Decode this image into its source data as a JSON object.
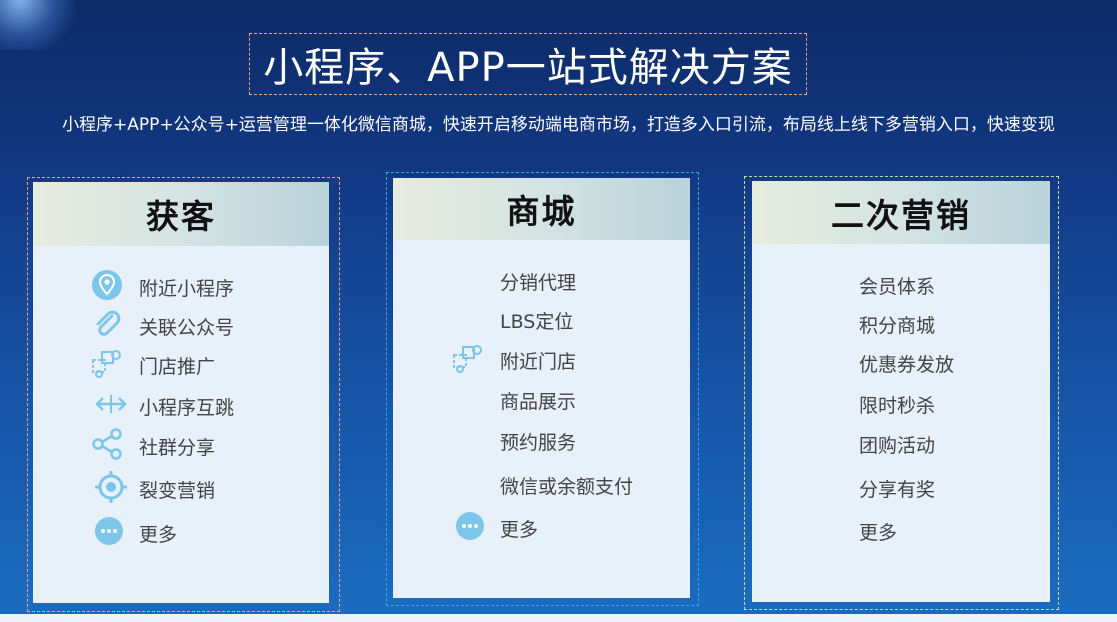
{
  "header": {
    "title": "小程序、APP一站式解决方案",
    "subtitle": "小程序+APP+公众号+运营管理一体化微信商城，快速开启移动端电商市场，打造多入口引流，布局线上线下多营销入口，快速变现"
  },
  "cards": [
    {
      "title": "获客",
      "border_color": "#f0a27e",
      "items": [
        {
          "label": "附近小程序",
          "icon": "location-pin-icon"
        },
        {
          "label": "关联公众号",
          "icon": "paperclip-icon"
        },
        {
          "label": "门店推广",
          "icon": "store-settings-icon"
        },
        {
          "label": "小程序互跳",
          "icon": "horizontal-arrows-icon"
        },
        {
          "label": "社群分享",
          "icon": "share-icon"
        },
        {
          "label": "裂变营销",
          "icon": "target-icon"
        },
        {
          "label": "更多",
          "icon": "more-dots-icon"
        }
      ]
    },
    {
      "title": "商城",
      "border_color": "#2fa8f0",
      "items": [
        {
          "label": "分销代理"
        },
        {
          "label": "LBS定位"
        },
        {
          "label": "附近门店",
          "icon": "store-settings-icon"
        },
        {
          "label": "商品展示"
        },
        {
          "label": "预约服务"
        },
        {
          "label": "微信或余额支付"
        },
        {
          "label": "更多",
          "icon": "more-dots-icon"
        }
      ]
    },
    {
      "title": "二次营销",
      "border_color": "#c9df8a",
      "items": [
        {
          "label": "会员体系"
        },
        {
          "label": "积分商城"
        },
        {
          "label": "优惠券发放"
        },
        {
          "label": "限时秒杀"
        },
        {
          "label": "团购活动"
        },
        {
          "label": "分享有奖"
        },
        {
          "label": "更多"
        }
      ]
    }
  ],
  "colors": {
    "icon_blue": "#7cc6ea",
    "card_background": "#e8f0f9"
  }
}
